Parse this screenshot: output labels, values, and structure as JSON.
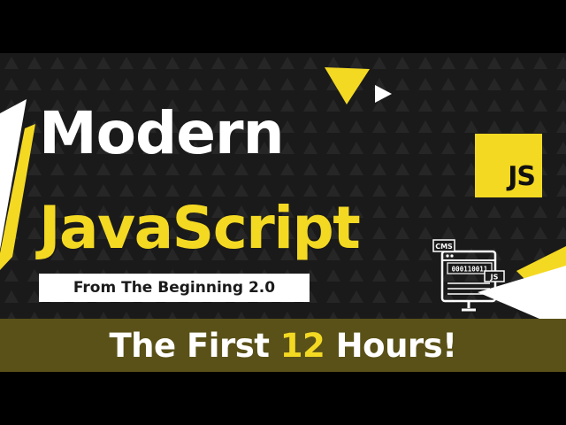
{
  "thumbnail": {
    "headline_line1": "Modern",
    "headline_line2": "JavaScript",
    "subtitle": "From The Beginning 2.0",
    "logo_text": "JS",
    "banner": {
      "prefix": "The First ",
      "number": "12",
      "suffix": " Hours!"
    },
    "illustration": {
      "cms_label": "CMS",
      "binary_text": "000110011",
      "js_label": "JS"
    }
  },
  "colors": {
    "background": "#1a1a1a",
    "letterbox": "#000000",
    "accent_yellow": "#f4d923",
    "banner_bg": "#5a5118",
    "text_white": "#ffffff"
  },
  "icons": [
    "js-logo-icon",
    "computer-code-icon",
    "triangle-decoration"
  ]
}
